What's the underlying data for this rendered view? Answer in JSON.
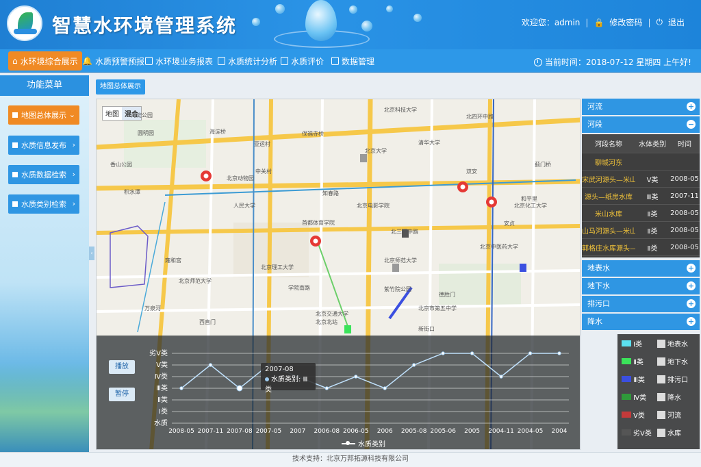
{
  "header": {
    "app_title": "智慧水环境管理系统",
    "welcome": "欢迎您：admin",
    "change_password": "修改密码",
    "logout": "退出",
    "sep": "|"
  },
  "nav": {
    "items": [
      {
        "label": "水环境综合展示",
        "active": true
      },
      {
        "label": "水质预警预报"
      },
      {
        "label": "水环境业务报表"
      },
      {
        "label": "水质统计分析"
      },
      {
        "label": "水质评价"
      },
      {
        "label": "数据管理"
      }
    ],
    "datetime": "当前时间：2018-07-12 星期四 上午好!"
  },
  "sidebar": {
    "title": "功能菜单",
    "items": [
      {
        "label": "地图总体展示",
        "active": true
      },
      {
        "label": "水质信息发布"
      },
      {
        "label": "水质数据检索"
      },
      {
        "label": "水质类别检索"
      }
    ]
  },
  "content": {
    "tab": "地图总体展示",
    "map_toggle": {
      "map": "地图",
      "hybrid": "混合"
    },
    "map_labels": [
      "海淀公园",
      "香山公园",
      "中关村",
      "北京大学",
      "清华大学",
      "圆明园",
      "北京科技大学",
      "北京理工大学",
      "北京师范大学",
      "北四环中路",
      "海淀桥",
      "保福寺桥",
      "学院南路",
      "北京北站",
      "新街口",
      "北京电影学院",
      "首都体育学院",
      "北京交通大学",
      "人民大学",
      "知春路",
      "北三环中路",
      "安贞",
      "和平里",
      "北京化工大学",
      "北京中医药大学",
      "西直门",
      "积水潭",
      "雍和宫",
      "德胜门",
      "北京市第五中学",
      "万泉河",
      "紫竹院公园",
      "亚运村",
      "双安",
      "北京动物园",
      "北京师范大学",
      "蓟门桥"
    ]
  },
  "chart": {
    "btn_play": "播放",
    "btn_pause": "暂停",
    "legend_label": "水质类别",
    "tooltip_date": "2007-08",
    "tooltip_value": "水质类别: Ⅲ类",
    "chart_data": {
      "type": "line",
      "title": "",
      "xlabel": "",
      "ylabel": "",
      "y_categories": [
        "水质",
        "Ⅰ类",
        "Ⅱ类",
        "Ⅲ类",
        "Ⅳ类",
        "Ⅴ类",
        "劣Ⅴ类"
      ],
      "categories": [
        "2008-05",
        "2007-11",
        "2007-08",
        "2007-05",
        "2007",
        "2006-08",
        "2006-05",
        "2006",
        "2005-08",
        "2005-06",
        "2005",
        "2004-11",
        "2004-05",
        "2004"
      ],
      "series": [
        {
          "name": "水质类别",
          "values": [
            3,
            5,
            3,
            5,
            4,
            3,
            4,
            3,
            5,
            6,
            6,
            4,
            6,
            6
          ]
        }
      ]
    }
  },
  "right_panel": {
    "sections": [
      "河流",
      "河段",
      "地表水",
      "地下水",
      "排污口",
      "降水"
    ],
    "table": {
      "headers": [
        "河段名称",
        "水体类别",
        "时间"
      ],
      "rows": [
        {
          "name": "聊城河东",
          "cls": "",
          "time": ""
        },
        {
          "name": "宋武河源头—米山水库",
          "cls": "Ⅴ类",
          "time": "2008-05"
        },
        {
          "name": "源头—纸房水库",
          "cls": "Ⅲ类",
          "time": "2007-11"
        },
        {
          "name": "米山水库",
          "cls": "Ⅱ类",
          "time": "2008-05"
        },
        {
          "name": "山马河源头—米山水库",
          "cls": "Ⅱ类",
          "time": "2008-05"
        },
        {
          "name": "郭格庄水库源头—入东母猪河口",
          "cls": "Ⅱ类",
          "time": "2008-05"
        }
      ]
    },
    "legend": [
      {
        "label": "Ⅰ类",
        "color": "#5ce0f0"
      },
      {
        "label": "Ⅱ类",
        "color": "#3be35a"
      },
      {
        "label": "Ⅲ类",
        "color": "#3b4fe0"
      },
      {
        "label": "Ⅳ类",
        "color": "#2f9a3a"
      },
      {
        "label": "Ⅴ类",
        "color": "#c43a3a"
      },
      {
        "label": "劣Ⅴ类",
        "color": "#555555"
      },
      {
        "label": "地表水",
        "icon": "surface-water-icon"
      },
      {
        "label": "地下水",
        "icon": "groundwater-icon"
      },
      {
        "label": "排污口",
        "icon": "outfall-icon"
      },
      {
        "label": "降水",
        "icon": "rainfall-icon"
      },
      {
        "label": "河流",
        "icon": "river-icon"
      },
      {
        "label": "水库",
        "icon": "reservoir-icon"
      }
    ]
  },
  "footer": "技术支持：北京万邦拓源科技有限公司",
  "colors": {
    "primary": "#2d98e8",
    "accent": "#f08a24",
    "panel_dark": "#3e3e3e"
  }
}
